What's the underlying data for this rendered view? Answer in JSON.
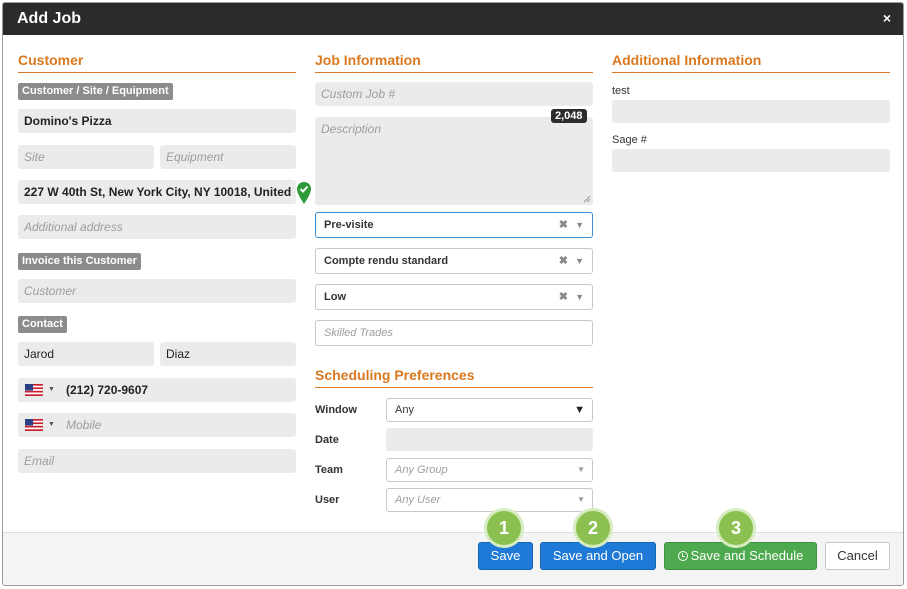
{
  "dialog": {
    "title": "Add Job",
    "close_label": "×"
  },
  "customer": {
    "section_title": "Customer",
    "tag_main": "Customer / Site / Equipment",
    "customer_value": "Domino's Pizza",
    "site_placeholder": "Site",
    "equipment_placeholder": "Equipment",
    "address_value": "227 W 40th St, New York City, NY 10018, United",
    "additional_address_placeholder": "Additional address",
    "tag_invoice": "Invoice this Customer",
    "invoice_placeholder": "Customer",
    "tag_contact": "Contact",
    "first_name": "Jarod",
    "last_name": "Diaz",
    "phone": "(212) 720-9607",
    "mobile_placeholder": "Mobile",
    "email_placeholder": "Email"
  },
  "job": {
    "section_title": "Job Information",
    "custom_job_placeholder": "Custom Job #",
    "description_placeholder": "Description",
    "char_counter": "2,048",
    "job_type": "Pre-visite",
    "report_template": "Compte rendu standard",
    "priority": "Low",
    "skilled_trades_placeholder": "Skilled Trades"
  },
  "scheduling": {
    "section_title": "Scheduling Preferences",
    "window_label": "Window",
    "window_value": "Any",
    "date_label": "Date",
    "team_label": "Team",
    "team_placeholder": "Any Group",
    "user_label": "User",
    "user_placeholder": "Any User"
  },
  "additional": {
    "section_title": "Additional Information",
    "field1_label": "test",
    "field2_label": "Sage #"
  },
  "footer": {
    "save_label": "Save",
    "save_open_label": "Save and Open",
    "save_schedule_label": "Save and Schedule",
    "cancel_label": "Cancel",
    "marker1": "1",
    "marker2": "2",
    "marker3": "3"
  },
  "icons": {
    "location": "map-pin-check-icon",
    "flag": "us-flag-icon",
    "clock": "clock-icon"
  },
  "colors": {
    "accent": "#d9781f",
    "primary": "#1f7ad7",
    "success": "#4eaa4e",
    "marker": "#8cc152"
  }
}
